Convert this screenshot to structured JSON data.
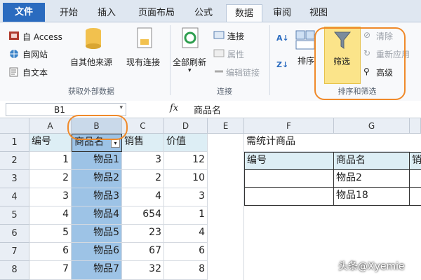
{
  "tabs": [
    "文件",
    "开始",
    "插入",
    "页面布局",
    "公式",
    "数据",
    "审阅",
    "视图"
  ],
  "ribbon": {
    "ext_access": "自 Access",
    "ext_web": "自网站",
    "ext_text": "自文本",
    "ext_other": "自其他来源",
    "existing_conn": "现有连接",
    "group_external": "获取外部数据",
    "refresh_all": "全部刷新",
    "conn": "连接",
    "props": "属性",
    "edit_links": "编辑链接",
    "group_conn": "连接",
    "sort": "排序",
    "filter": "筛选",
    "clear": "清除",
    "reapply": "重新应用",
    "advanced": "高级",
    "group_sort": "排序和筛选"
  },
  "formula_bar": {
    "name_box": "B1",
    "fx": "fx",
    "value": "商品名"
  },
  "columns": [
    "A",
    "B",
    "C",
    "D",
    "E",
    "F",
    "G"
  ],
  "rows": [
    "1",
    "2",
    "3",
    "4",
    "5",
    "6",
    "7",
    "8"
  ],
  "table": {
    "headers": [
      "编号",
      "商品名",
      "销售",
      "价值"
    ],
    "rows": [
      [
        "1",
        "物品1",
        "3",
        "12"
      ],
      [
        "2",
        "物品2",
        "2",
        "10"
      ],
      [
        "3",
        "物品3",
        "4",
        "3"
      ],
      [
        "4",
        "物品4",
        "654",
        "1"
      ],
      [
        "5",
        "物品5",
        "23",
        "4"
      ],
      [
        "6",
        "物品6",
        "67",
        "6"
      ],
      [
        "7",
        "物品7",
        "32",
        "8"
      ]
    ]
  },
  "criteria": {
    "title": "需统计商品",
    "headers": [
      "编号",
      "商品名",
      "销"
    ],
    "items": [
      "物品2",
      "物品18"
    ]
  },
  "watermark": "头条@Xyemie",
  "colors": {
    "file_tab": "#2a6bbf",
    "highlight": "#fbe48a",
    "annotation": "#f08a2a",
    "selected_col": "#9dc3e6"
  }
}
